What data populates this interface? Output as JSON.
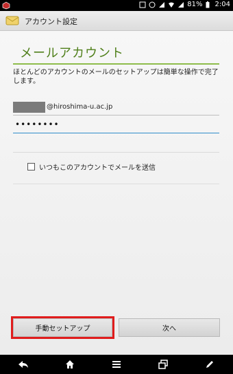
{
  "status_bar": {
    "battery": "81%",
    "time": "2:04"
  },
  "header": {
    "title": "アカウント設定"
  },
  "main": {
    "page_title": "メールアカウント",
    "description": "ほとんどのアカウントのメールのセットアップは簡単な操作で完了します。",
    "email": {
      "domain": "@hiroshima-u.ac.jp"
    },
    "password": {
      "masked": "••••••••"
    },
    "checkbox_label": "いつもこのアカウントでメールを送信"
  },
  "buttons": {
    "manual_setup": "手動セットアップ",
    "next": "次へ"
  },
  "icons": {
    "status_left": "notification-icon",
    "app": "account-settings-icon",
    "nav": [
      "back-icon",
      "home-icon",
      "menu-icon",
      "recent-apps-icon",
      "edit-icon"
    ]
  },
  "colors": {
    "title_accent": "#4f7f1a",
    "underline_accent": "#8ebc4b",
    "focused_field": "#2e8bc9",
    "highlight_border": "#e01c1c"
  }
}
